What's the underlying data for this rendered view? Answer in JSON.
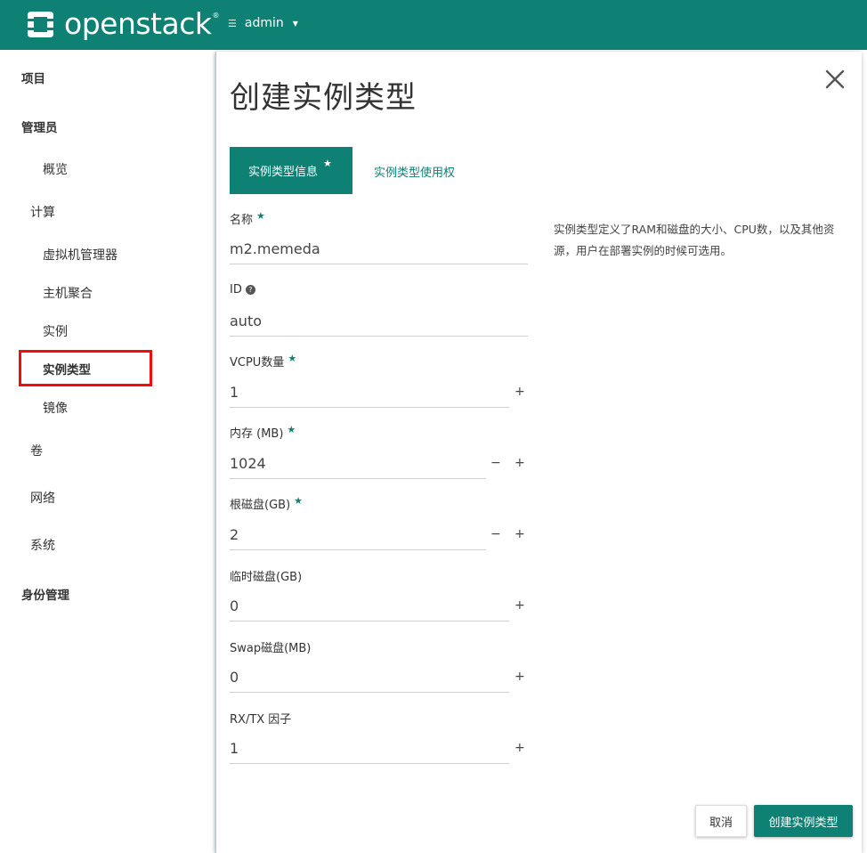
{
  "brand": {
    "name": "openstack",
    "reg": "®"
  },
  "header": {
    "project_label": "admin"
  },
  "sidebar": {
    "items": [
      {
        "label": "项目"
      },
      {
        "label": "管理员"
      },
      {
        "label": "概览"
      },
      {
        "label": "计算"
      },
      {
        "label": "虚拟机管理器"
      },
      {
        "label": "主机聚合"
      },
      {
        "label": "实例"
      },
      {
        "label": "实例类型"
      },
      {
        "label": "镜像"
      },
      {
        "label": "卷"
      },
      {
        "label": "网络"
      },
      {
        "label": "系统"
      },
      {
        "label": "身份管理"
      }
    ]
  },
  "modal": {
    "title": "创建实例类型",
    "tabs": [
      {
        "label": "实例类型信息",
        "required": "★"
      },
      {
        "label": "实例类型使用权"
      }
    ],
    "help_text": "实例类型定义了RAM和磁盘的大小、CPU数，以及其他资源，用户在部署实例的时候可选用。",
    "fields": {
      "name": {
        "label": "名称",
        "value": "m2.memeda"
      },
      "id": {
        "label": "ID",
        "value": "auto"
      },
      "vcpus": {
        "label": "VCPU数量",
        "value": "1"
      },
      "ram": {
        "label": "内存 (MB)",
        "value": "1024"
      },
      "disk": {
        "label": "根磁盘(GB)",
        "value": "2"
      },
      "ephemeral": {
        "label": "临时磁盘(GB)",
        "value": "0"
      },
      "swap": {
        "label": "Swap磁盘(MB)",
        "value": "0"
      },
      "rxtx": {
        "label": "RX/TX 因子",
        "value": "1"
      }
    },
    "required_mark": "★",
    "help_mark": "?",
    "plus": "+",
    "minus": "−",
    "cancel_label": "取消",
    "submit_label": "创建实例类型"
  },
  "colors": {
    "brand": "#0f8174",
    "highlight": "#f20c0c"
  }
}
